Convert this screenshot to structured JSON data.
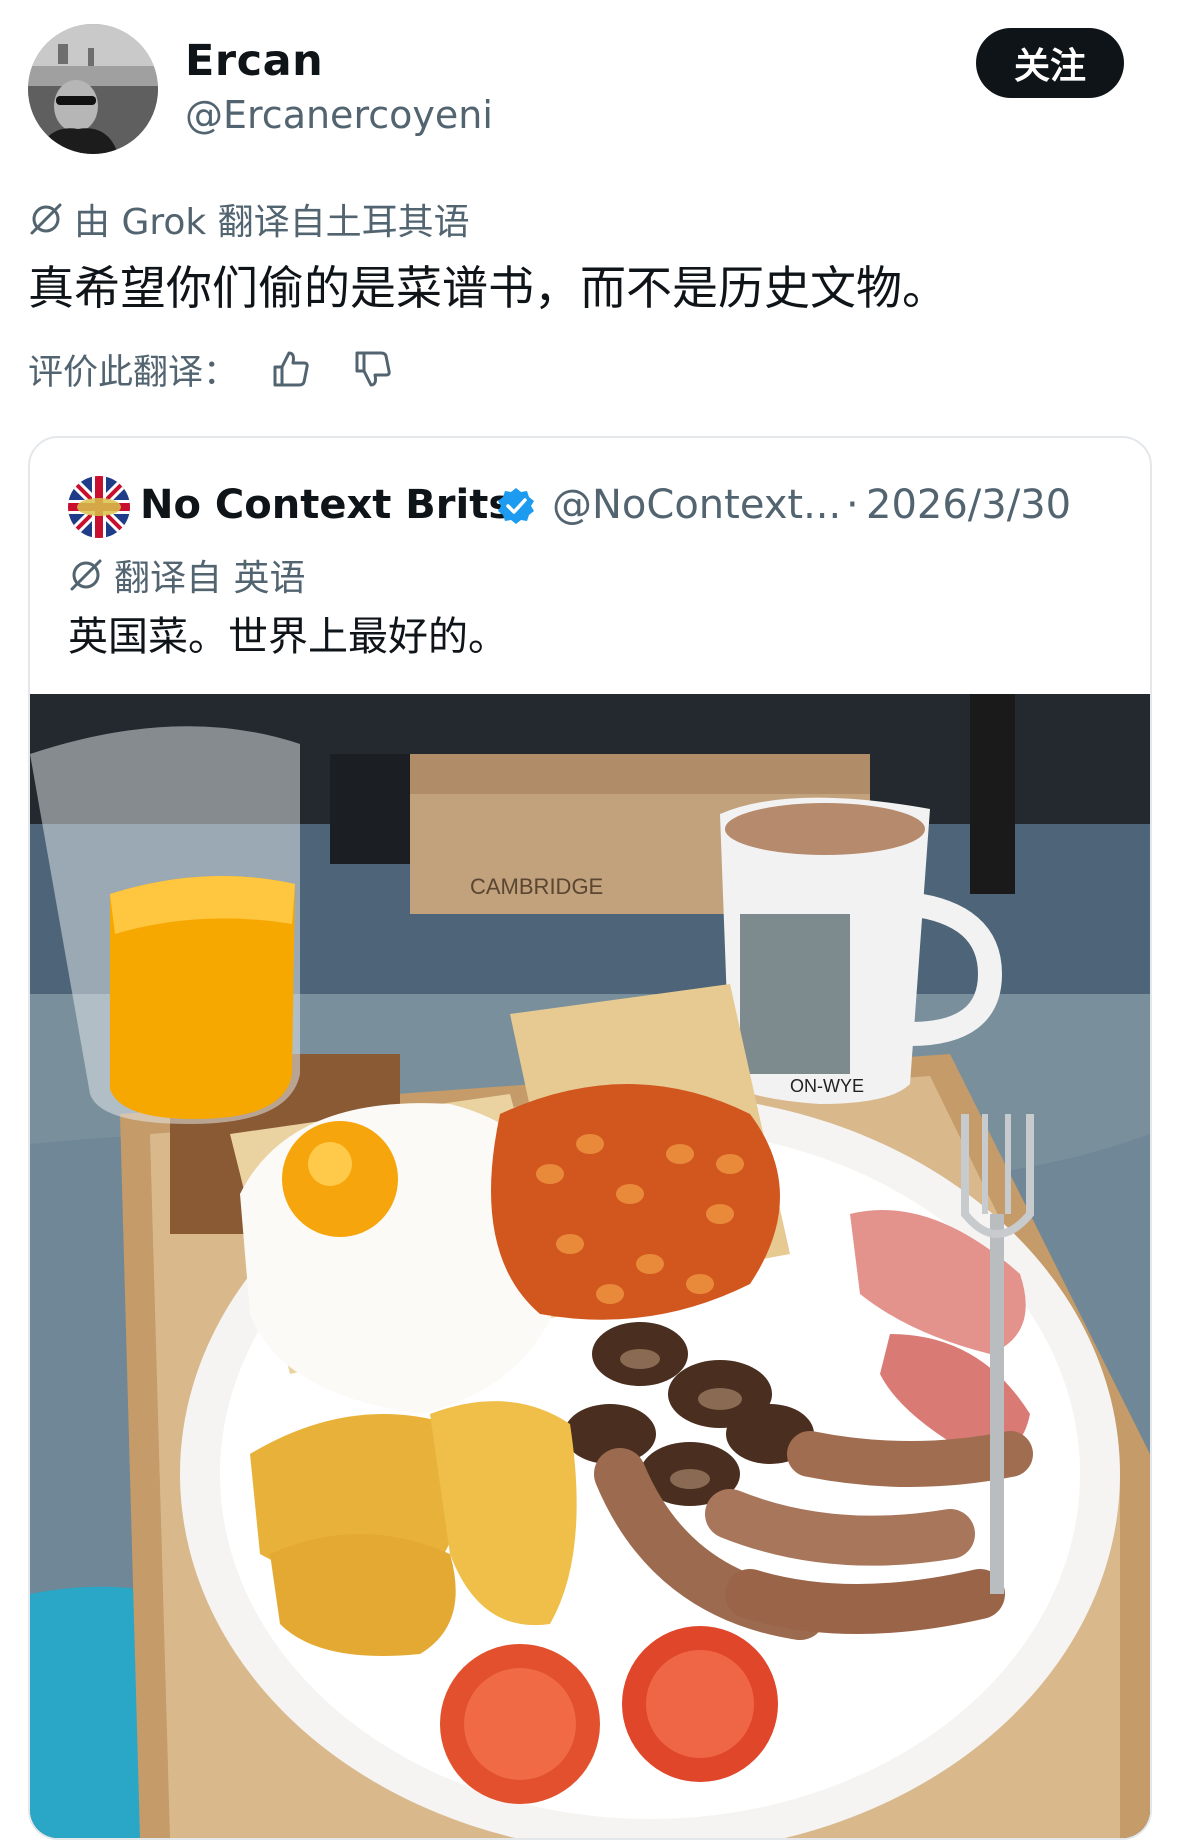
{
  "tweet": {
    "author_name": "Ercan",
    "author_handle": "@Ercanercoyeni",
    "follow_label": "关注",
    "translation_label": "由 Grok 翻译自土耳其语",
    "text": "真希望你们偷的是菜谱书，而不是历史文物。",
    "rate_label": "评价此翻译："
  },
  "quoted_tweet": {
    "author_name": "No Context Brits",
    "author_handle": "@NoContext...",
    "separator": "·",
    "date": "2026/3/30",
    "translation_label": "翻译自 英语",
    "text": "英国菜。世界上最好的。",
    "media_text": {
      "box_label": "CAMBRIDGE",
      "mug_label": "ON-WYE"
    }
  },
  "colors": {
    "text_primary": "#0f1419",
    "text_secondary": "#536471",
    "verified_blue": "#1d9bf0",
    "button_bg": "#0f1419",
    "card_border": "#e4e8eb"
  },
  "icons": [
    "translate-icon",
    "thumbs-up-icon",
    "thumbs-down-icon",
    "verified-badge-icon"
  ]
}
